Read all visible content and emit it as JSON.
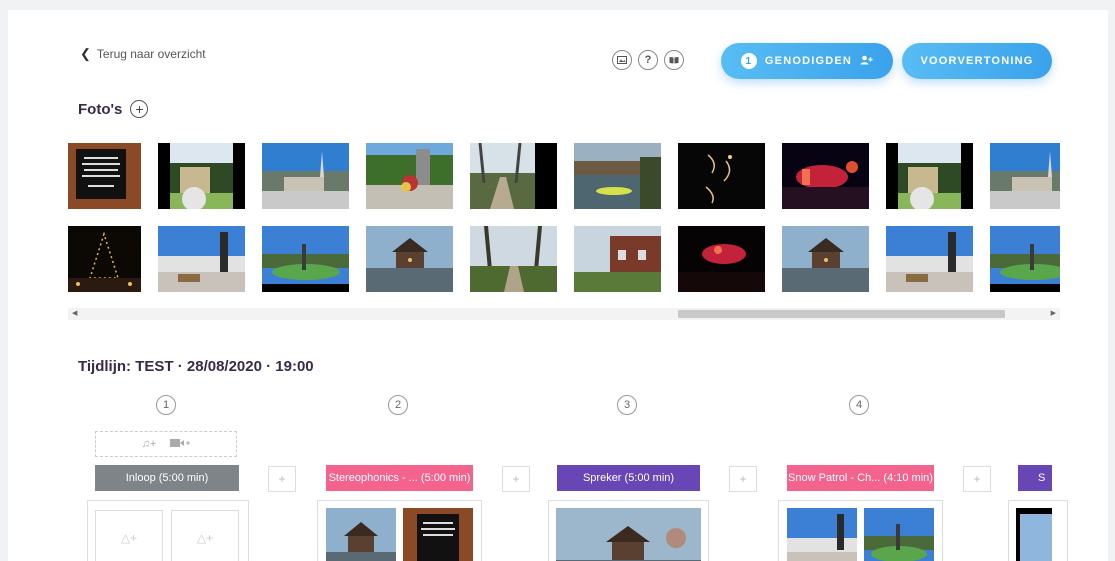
{
  "header": {
    "back_label": "Terug naar overzicht",
    "guests_count": "1",
    "guests_label": "GENODIGDEN",
    "preview_label": "VOORVERTONING"
  },
  "photos": {
    "title": "Foto's"
  },
  "timeline": {
    "title": "Tijdlijn: TEST · 28/08/2020 · 19:00",
    "steps": [
      "1",
      "2",
      "3",
      "4"
    ],
    "segments": [
      {
        "label": "Inloop (5:00 min)"
      },
      {
        "label": "Stereophonics - ... (5:00 min)"
      },
      {
        "label": "Spreker (5:00 min)"
      },
      {
        "label": "Snow Patrol - Ch... (4:10 min)"
      },
      {
        "label": "S"
      }
    ]
  },
  "icons": {
    "back": "chevron-left-icon",
    "gallery": "image-icon",
    "help": "question-icon",
    "guide": "book-icon",
    "add_guest": "user-plus-icon",
    "add": "plus-icon",
    "music": "music-note-icon",
    "video": "video-camera-icon"
  },
  "colors": {
    "primary_blue": "#3aa2ec",
    "segment_gray": "#7f8489",
    "segment_pink": "#f3638d",
    "segment_purple": "#6846b6"
  }
}
